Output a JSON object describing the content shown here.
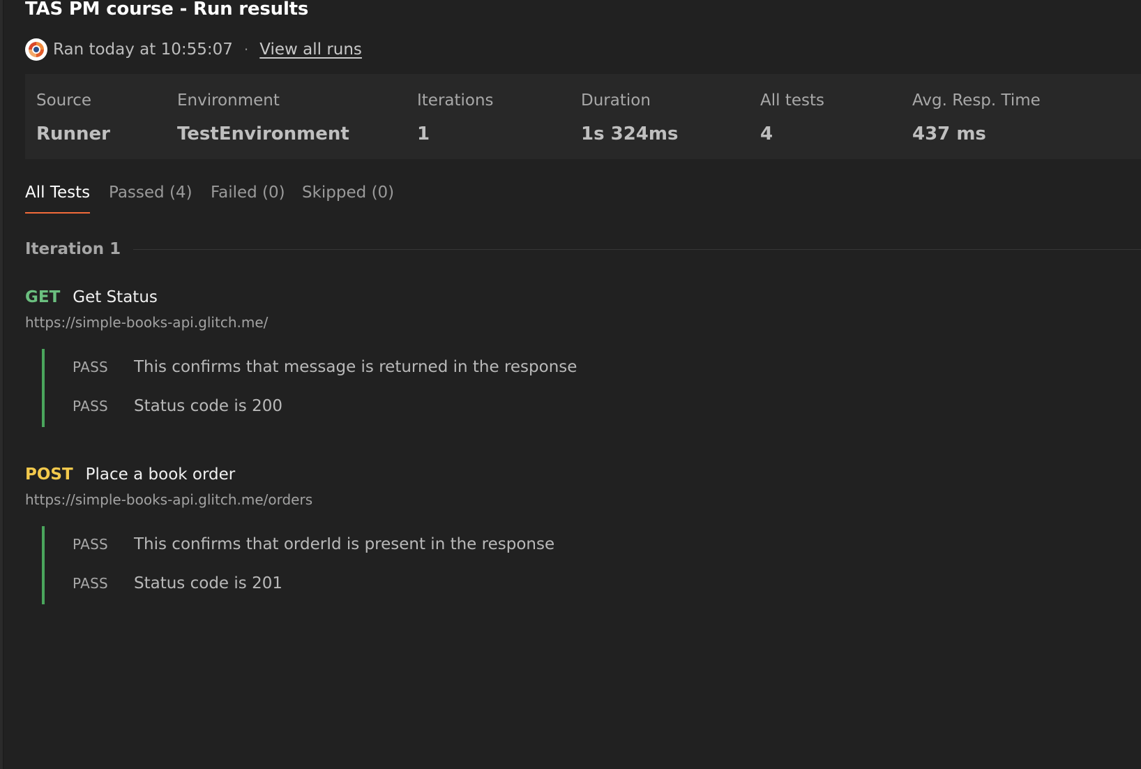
{
  "title": "TAS PM course - Run results",
  "meta": {
    "ran_text": "Ran today at 10:55:07",
    "separator": "·",
    "view_all_runs": "View all runs"
  },
  "summary": {
    "source": {
      "label": "Source",
      "value": "Runner"
    },
    "environment": {
      "label": "Environment",
      "value": "TestEnvironment"
    },
    "iterations": {
      "label": "Iterations",
      "value": "1"
    },
    "duration": {
      "label": "Duration",
      "value": "1s 324ms"
    },
    "all_tests": {
      "label": "All tests",
      "value": "4"
    },
    "avg_resp_time": {
      "label": "Avg. Resp. Time",
      "value": "437 ms"
    }
  },
  "tabs": [
    {
      "label": "All Tests",
      "active": true
    },
    {
      "label": "Passed (4)",
      "active": false
    },
    {
      "label": "Failed (0)",
      "active": false
    },
    {
      "label": "Skipped (0)",
      "active": false
    }
  ],
  "iteration_label": "Iteration 1",
  "requests": [
    {
      "method": "GET",
      "name": "Get Status",
      "url": "https://simple-books-api.glitch.me/",
      "tests": [
        {
          "status": "PASS",
          "name": "This confirms that message is returned in the response"
        },
        {
          "status": "PASS",
          "name": "Status code is 200"
        }
      ]
    },
    {
      "method": "POST",
      "name": "Place a book order",
      "url": "https://simple-books-api.glitch.me/orders",
      "tests": [
        {
          "status": "PASS",
          "name": "This confirms that orderId is present in the response"
        },
        {
          "status": "PASS",
          "name": "Status code is 201"
        }
      ]
    }
  ],
  "colors": {
    "background": "#212121",
    "summary_bg": "#282828",
    "tab_accent": "#f26b3a",
    "get_method": "#6bbf7f",
    "post_method": "#f3c94c",
    "pass_bar": "#4aa55c"
  }
}
